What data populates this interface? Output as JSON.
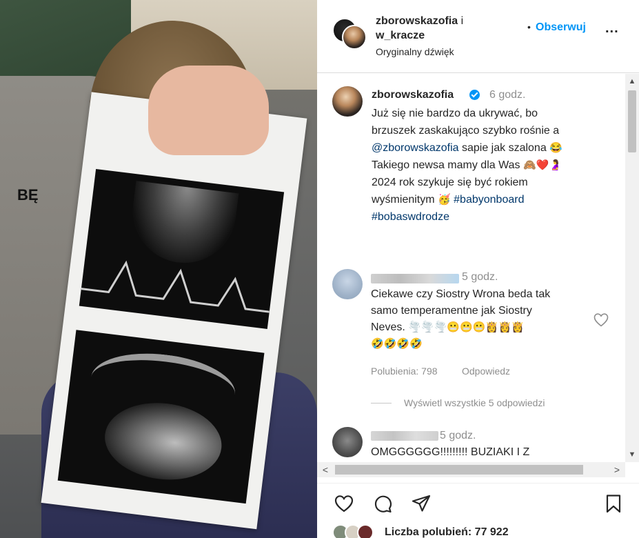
{
  "media": {
    "overlay_text": "BĘ"
  },
  "header": {
    "user1": "zborowskazofia",
    "joiner": "i",
    "user2": "w_kracze",
    "audio": "Oryginalny dźwięk",
    "dot": "•",
    "follow_label": "Obserwuj",
    "more_label": "..."
  },
  "caption": {
    "username": "zborowskazofia",
    "time": "6 godz.",
    "line1": "Już się nie bardzo da ukrywać, bo",
    "line2": "brzuszek zaskakująco szybko rośnie a",
    "mention": "@zborowskazofia",
    "line3_rest": "sapie jak szalona",
    "line3_emoji": "😂",
    "line4": "Takiego newsa mamy dla Was",
    "line4_emoji": "🙈❤️🤰",
    "line5": "2024 rok szykuje się być rokiem",
    "line6": "wyśmienitym",
    "line6_emoji": "🥳",
    "tag1": "#babyonboard",
    "tag2": "#bobaswdrodze"
  },
  "comment1": {
    "time": "5 godz.",
    "line1": "Ciekawe czy Siostry Wrona beda tak",
    "line2": "samo temperamentne jak Siostry",
    "line3": "Neves.",
    "line3_emoji": "🌪️🌪️🌪️😬😬😬👸👸👸",
    "line4_emoji": "🤣🤣🤣🤣",
    "likes": "Polubienia: 798",
    "reply": "Odpowiedz",
    "view_replies": "Wyświetl wszystkie 5 odpowiedzi"
  },
  "comment2": {
    "time": "5 godz.",
    "text": "OMGGGGGG!!!!!!!!! BUZIAKI I Z"
  },
  "scrollbars": {
    "up": "▲",
    "down": "▼",
    "left": "<",
    "right": ">"
  },
  "likes_line": "Liczba polubień: 77 922",
  "colors": {
    "accent": "#0095f6",
    "link": "#00376b",
    "muted": "#8e8e8e",
    "text": "#262626"
  }
}
